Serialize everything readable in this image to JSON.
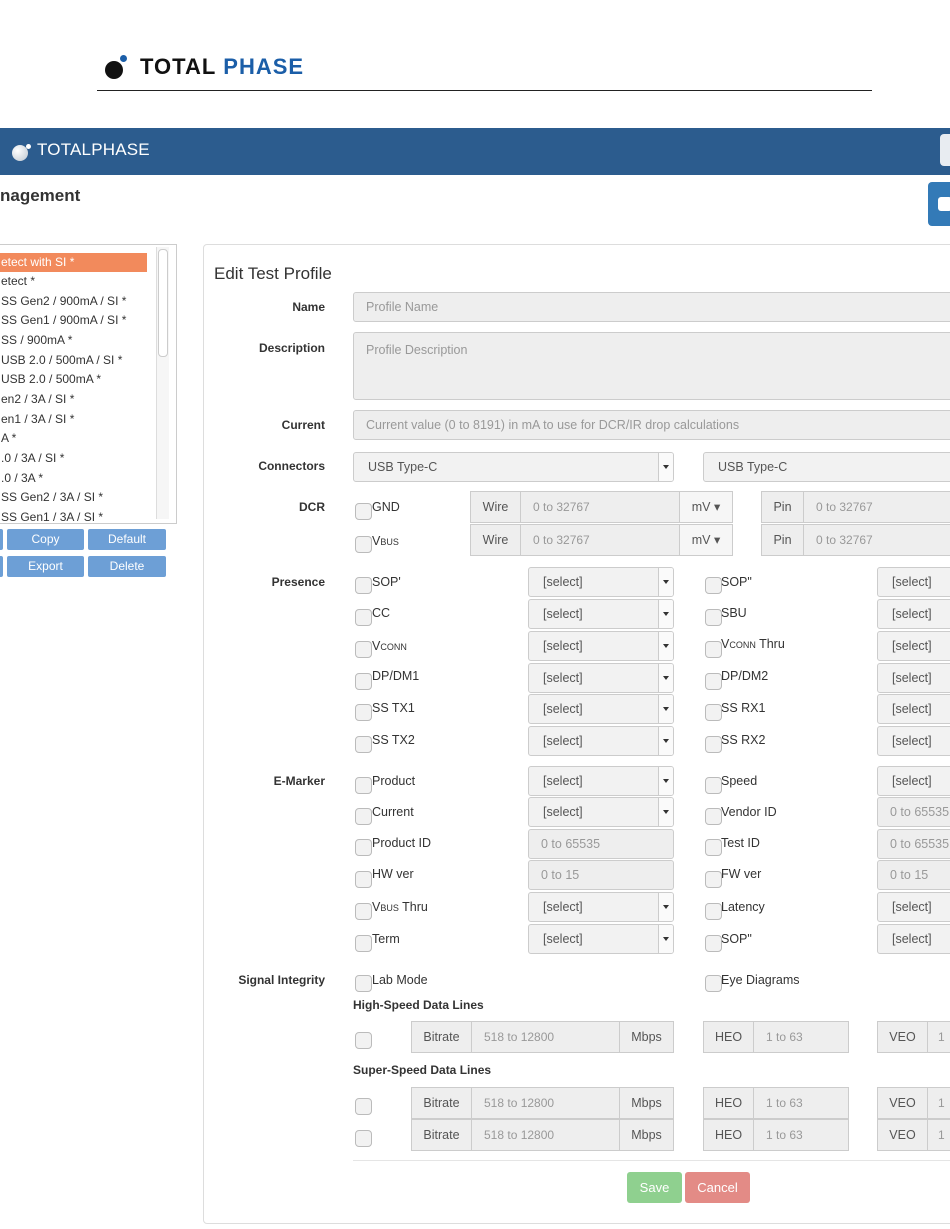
{
  "doc_header": {
    "logo_word1": "TOTAL",
    "logo_word2": "PHASE"
  },
  "app": {
    "logo_text": "TOTALPHASE",
    "page_title": "nagement"
  },
  "profile_list": {
    "items": [
      "etect with SI *",
      "etect *",
      "SS Gen2 / 900mA / SI *",
      "SS Gen1 / 900mA / SI *",
      "SS / 900mA *",
      "USB 2.0 / 500mA / SI *",
      "USB 2.0 / 500mA *",
      "en2 / 3A / SI *",
      "en1 / 3A / SI *",
      "A *",
      ".0 / 3A / SI *",
      ".0 / 3A *",
      "SS Gen2 / 3A / SI *",
      "SS Gen1 / 3A / SI *"
    ],
    "selected_index": 0
  },
  "list_buttons": {
    "copy": "Copy",
    "default": "Default",
    "export": "Export",
    "delete": "Delete"
  },
  "form": {
    "title": "Edit Test Profile",
    "labels": {
      "name": "Name",
      "description": "Description",
      "current": "Current",
      "connectors": "Connectors",
      "dcr": "DCR",
      "presence": "Presence",
      "emarker": "E-Marker",
      "signal_integrity": "Signal Integrity"
    },
    "name_placeholder": "Profile Name",
    "description_placeholder": "Profile Description",
    "current_placeholder": "Current value (0 to 8191) in mA to use for DCR/IR drop calculations",
    "connector_left": "USB Type-C",
    "connector_right": "USB Type-C",
    "dcr": {
      "gnd": "GND",
      "vbus_main": "V",
      "vbus_sub": "BUS",
      "wire": "Wire",
      "pin": "Pin",
      "range": "0 to 32767",
      "unit": "mV"
    },
    "select_text": "[select]",
    "presence": {
      "sop_p": "SOP'",
      "sop_pp": "SOP\"",
      "cc": "CC",
      "sbu": "SBU",
      "vconn_main": "V",
      "vconn_sub": "CONN",
      "thru": " Thru",
      "dpdm1": "DP/DM1",
      "dpdm2": "DP/DM2",
      "sstx1": "SS TX1",
      "ssrx1": "SS RX1",
      "sstx2": "SS TX2",
      "ssrx2": "SS RX2"
    },
    "emarker": {
      "product": "Product",
      "speed": "Speed",
      "current": "Current",
      "vendor_id": "Vendor ID",
      "product_id": "Product ID",
      "test_id": "Test ID",
      "hw_ver": "HW ver",
      "fw_ver": "FW ver",
      "vbus_main": "V",
      "vbus_sub": "BUS",
      "thru": " Thru",
      "latency": "Latency",
      "term": "Term",
      "sop_pp": "SOP\"",
      "range_65535": "0 to 65535",
      "range_65535_cut": "0 to 65535",
      "range_15": "0 to 15"
    },
    "signal_integrity": {
      "lab_mode": "Lab Mode",
      "eye_diagrams": "Eye Diagrams",
      "high_speed_heading": "High-Speed Data Lines",
      "super_speed_heading": "Super-Speed Data Lines",
      "bitrate": "Bitrate",
      "bitrate_range": "518 to 12800",
      "mbps": "Mbps",
      "heo": "HEO",
      "heo_range": "1 to 63",
      "veo": "VEO",
      "veo_range_cut": "1"
    },
    "save": "Save",
    "cancel": "Cancel"
  },
  "colors": {
    "app_bar": "#2c5c8e",
    "selected_row": "#f28a5c",
    "save": "#8fd08f",
    "cancel": "#e38b86",
    "list_button": "#6d9fd6"
  }
}
